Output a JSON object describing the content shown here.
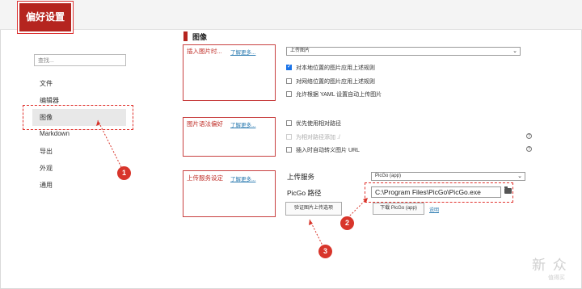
{
  "app": {
    "title": "偏好设置"
  },
  "sidebar": {
    "search_placeholder": "查找...",
    "items": [
      {
        "label": "文件"
      },
      {
        "label": "编辑器"
      },
      {
        "label": "图像"
      },
      {
        "label": "Markdown"
      },
      {
        "label": "导出"
      },
      {
        "label": "外观"
      },
      {
        "label": "通用"
      }
    ],
    "active_index": 2
  },
  "main": {
    "section_title": "图像",
    "insert_group": {
      "label": "插入图片时...",
      "learn_more": "了解更多...",
      "select_value": "上传图片",
      "options": [
        {
          "label": "对本地位置的图片应用上述规则",
          "checked": true
        },
        {
          "label": "对网络位置的图片应用上述规则",
          "checked": false
        },
        {
          "label": "允许根据 YAML 设置自动上传图片",
          "checked": false
        }
      ]
    },
    "syntax_group": {
      "label": "图片语法偏好",
      "learn_more": "了解更多...",
      "options": [
        {
          "label": "优先使用相对路径",
          "checked": false
        },
        {
          "label": "为相对路径添加 ./",
          "checked": false,
          "disabled": true
        },
        {
          "label": "插入时自动转义图片 URL",
          "checked": false
        }
      ],
      "help_icon": "?"
    },
    "upload_group": {
      "label": "上传服务设定",
      "learn_more": "了解更多...",
      "service_label": "上传服务",
      "service_value": "PicGo (app)",
      "path_label": "PicGo 路径",
      "path_value": "C:\\Program Files\\PicGo\\PicGo.exe",
      "download_button": "下载 PicGo (app)",
      "help_link": "说明",
      "verify_button": "验证图片上传选项"
    }
  },
  "annotations": {
    "badge1": "1",
    "badge2": "2",
    "badge3": "3"
  },
  "watermark": {
    "main": "新 众",
    "sub": "值得买"
  },
  "colors": {
    "accent": "#b5251f",
    "annotation": "#d8352b",
    "checkbox": "#1a73e8"
  }
}
